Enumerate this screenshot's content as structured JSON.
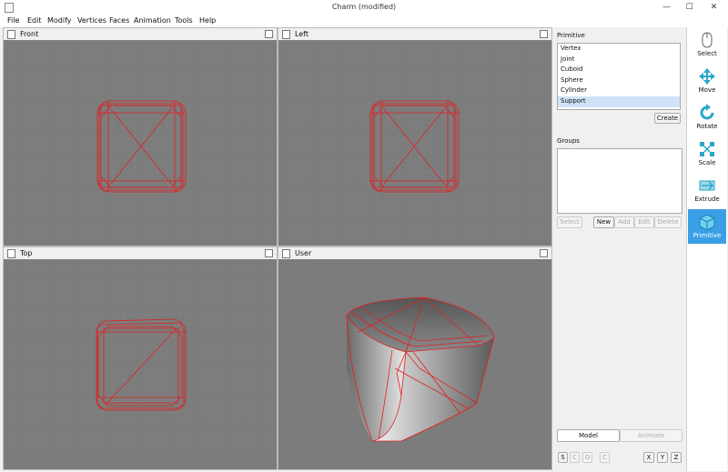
{
  "window": {
    "title": "Charm (modified)",
    "minimize": "—",
    "maximize": "☐",
    "close": "✕"
  },
  "menu": [
    "File",
    "Edit",
    "Modify",
    "Vertices",
    "Faces",
    "Animation",
    "Tools",
    "Help"
  ],
  "viewports": {
    "front": "Front",
    "left": "Left",
    "top": "Top",
    "user": "User"
  },
  "primitive": {
    "label": "Primitive",
    "items": [
      "Vertex",
      "Joint",
      "Cuboid",
      "Sphere",
      "Cylinder",
      "Support"
    ],
    "selected": "Support",
    "create": "Create"
  },
  "groups": {
    "label": "Groups",
    "buttons": {
      "select": "Select",
      "new": "New",
      "add": "Add",
      "edit": "Edit",
      "delete": "Delete"
    }
  },
  "mode": {
    "model": "Model",
    "animate": "Animate"
  },
  "axis": {
    "s": "S",
    "c": "C",
    "o": "O",
    "c2": "C",
    "x": "X",
    "y": "Y",
    "z": "Z"
  },
  "tools": [
    {
      "label": "Select",
      "icon": "mouse-icon"
    },
    {
      "label": "Move",
      "icon": "move-arrows-icon"
    },
    {
      "label": "Rotate",
      "icon": "rotate-icon"
    },
    {
      "label": "Scale",
      "icon": "scale-icon"
    },
    {
      "label": "Extrude",
      "icon": "extrude-icon"
    },
    {
      "label": "Primitive",
      "icon": "cube-icon"
    }
  ],
  "colors": {
    "wire": "#e02020",
    "viewport_bg": "#7c7c7c",
    "grid": "#8a8a8a",
    "active_tool": "#3a9fe6"
  }
}
